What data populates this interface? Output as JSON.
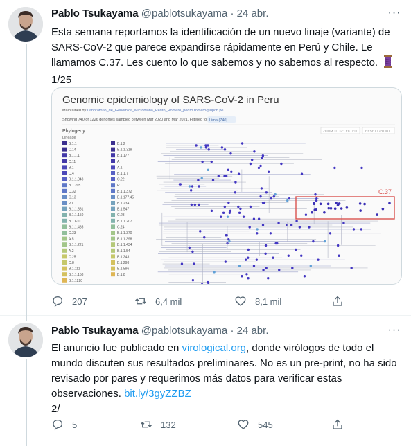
{
  "tweets": [
    {
      "author_name": "Pablo Tsukayama",
      "author_handle": "@pablotsukayama",
      "separator": "·",
      "date": "24 abr.",
      "text_lines": [
        "Esta semana reportamos la identificación de un nuevo linaje (variante) de",
        "SARS-CoV-2 que parece expandirse rápidamente en Perú y Chile. Le",
        "llamamos C.37.  Les cuento lo que sabemos y no sabemos al respecto.",
        "1/25"
      ],
      "emoji_icon": "thread-spool-icon",
      "stats": {
        "replies": "207",
        "retweets": "6,4 mil",
        "likes": "8,1 mil"
      },
      "media": {
        "title": "Genomic epidemiology of SARS-CoV-2 in Peru",
        "maintained_prefix": "Maintained by ",
        "maintained_link": "Laboratorio_de_Genomica_Microbiana_Pedro_Romero_pedro.romero@upch.pe.",
        "showing": "Showing 740 of 1226 genomes sampled between Mar 2020 and Mar 2021. Filtered to",
        "filter_chip": "Lima (740)",
        "legend_title": "Phylogeny",
        "legend_subtitle": "Lineage",
        "zoom_button": "ZOOM TO SELECTED",
        "reset_button": "RESET LAYOUT",
        "highlight_label": "C.37",
        "lineages_col1": [
          "B.1.1",
          "C.14",
          "B.1.1.1",
          "C.11",
          "B.1",
          "C.4",
          "B.1.1.348",
          "B.1.205",
          "C.32",
          "C.13",
          "P.1",
          "B.1.1.381",
          "B.1.1.150",
          "B.1.610",
          "B.1.1.485",
          "C.33",
          "A.5",
          "B.1.1.221",
          "A.2",
          "C.25",
          "C.8",
          "B.1.111",
          "B.1.1.158",
          "B.1.1220"
        ],
        "lineages_col2": [
          "B.1.2",
          "B.1.1.319",
          "B.1.177",
          "A",
          "A.1",
          "B.1.1.7",
          "C.22",
          "R",
          "B.1.1.372",
          "B.1.177.45",
          "B.1.234",
          "B.1.547",
          "C.23",
          "B.1.1.207",
          "C.24",
          "B.1.1.370",
          "B.1.1.398",
          "B.1.1.434",
          "B.1.1.54",
          "B.1.243",
          "B.1.298",
          "B.1.596",
          "B.1.8"
        ]
      }
    },
    {
      "author_name": "Pablo Tsukayama",
      "author_handle": "@pablotsukayama",
      "separator": "·",
      "date": "24 abr.",
      "text_prefix": "El anuncio fue publicado en ",
      "text_link": "virological.org",
      "text_line1_suffix": ", donde virólogos de todo el",
      "text_lines_rest": [
        "mundo discuten sus resultados preliminares. No es un pre-print, no ha sido",
        "revisado por pares y requerimos más datos para verificar estas"
      ],
      "text_line4_prefix": "observaciones. ",
      "text_link2": "bit.ly/3gyZZBZ",
      "text_last": "2/",
      "stats": {
        "replies": "5",
        "retweets": "132",
        "likes": "545"
      }
    }
  ],
  "more_icon": "more-options-icon",
  "colors": {
    "link": "#1d9bf0",
    "muted": "#536471",
    "highlight_box": "#d9534f"
  }
}
